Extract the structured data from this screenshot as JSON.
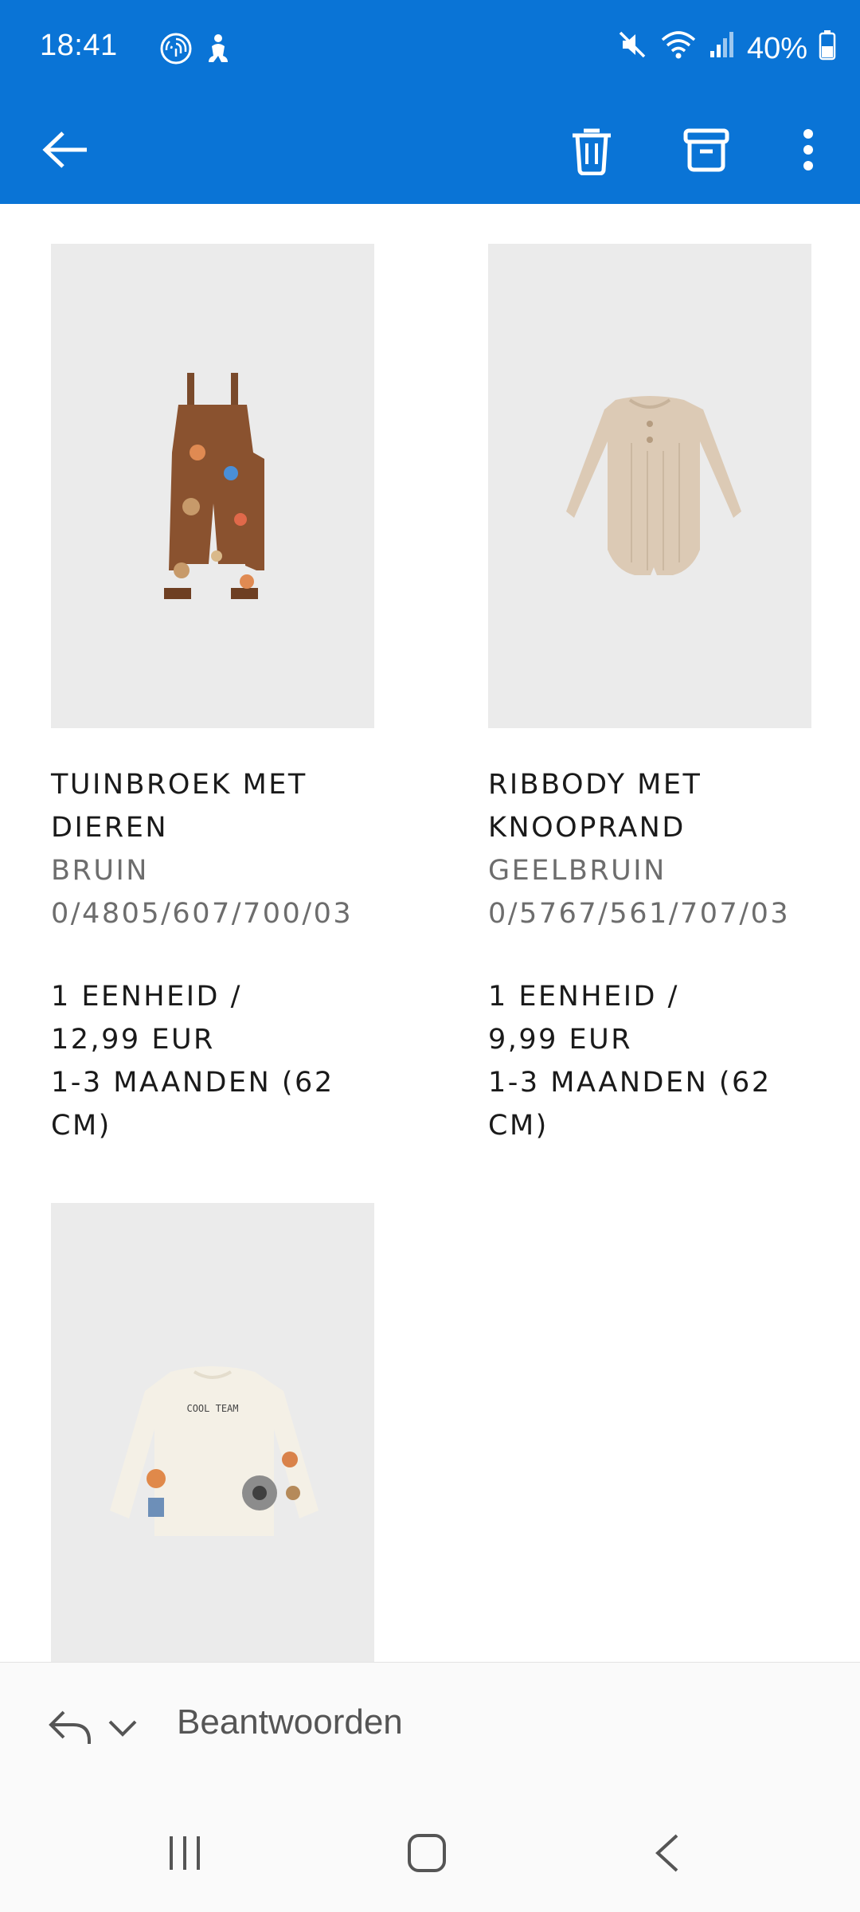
{
  "status_bar": {
    "time": "18:41",
    "battery": "40%",
    "icons": [
      "fingerprint-icon",
      "accessibility-icon",
      "mute-icon",
      "wifi-icon",
      "signal-icon",
      "battery-icon"
    ]
  },
  "app_bar": {
    "actions": [
      "back-arrow-icon",
      "trash-icon",
      "archive-icon",
      "more-vertical-icon"
    ],
    "color": "#0a74d6"
  },
  "products": [
    {
      "name": "TUINBROEK MET DIEREN",
      "color": "BRUIN",
      "ref": "0/4805/607/700/03",
      "quantity": "1 EENHEID /",
      "price": "12,99 EUR",
      "size": "1-3 MAANDEN (62 CM)"
    },
    {
      "name": "RIBBODY MET KNOOPRAND",
      "color": "GEELBRUIN",
      "ref": "0/5767/561/707/03",
      "quantity": "1 EENHEID /",
      "price": "9,99 EUR",
      "size": "1-3 MAANDEN (62 CM)"
    },
    {
      "print_text": "COOL TEAM"
    }
  ],
  "reply_bar": {
    "label": "Beantwoorden"
  },
  "nav_bar": {
    "buttons": [
      "recent-apps-icon",
      "home-icon",
      "back-icon"
    ]
  }
}
